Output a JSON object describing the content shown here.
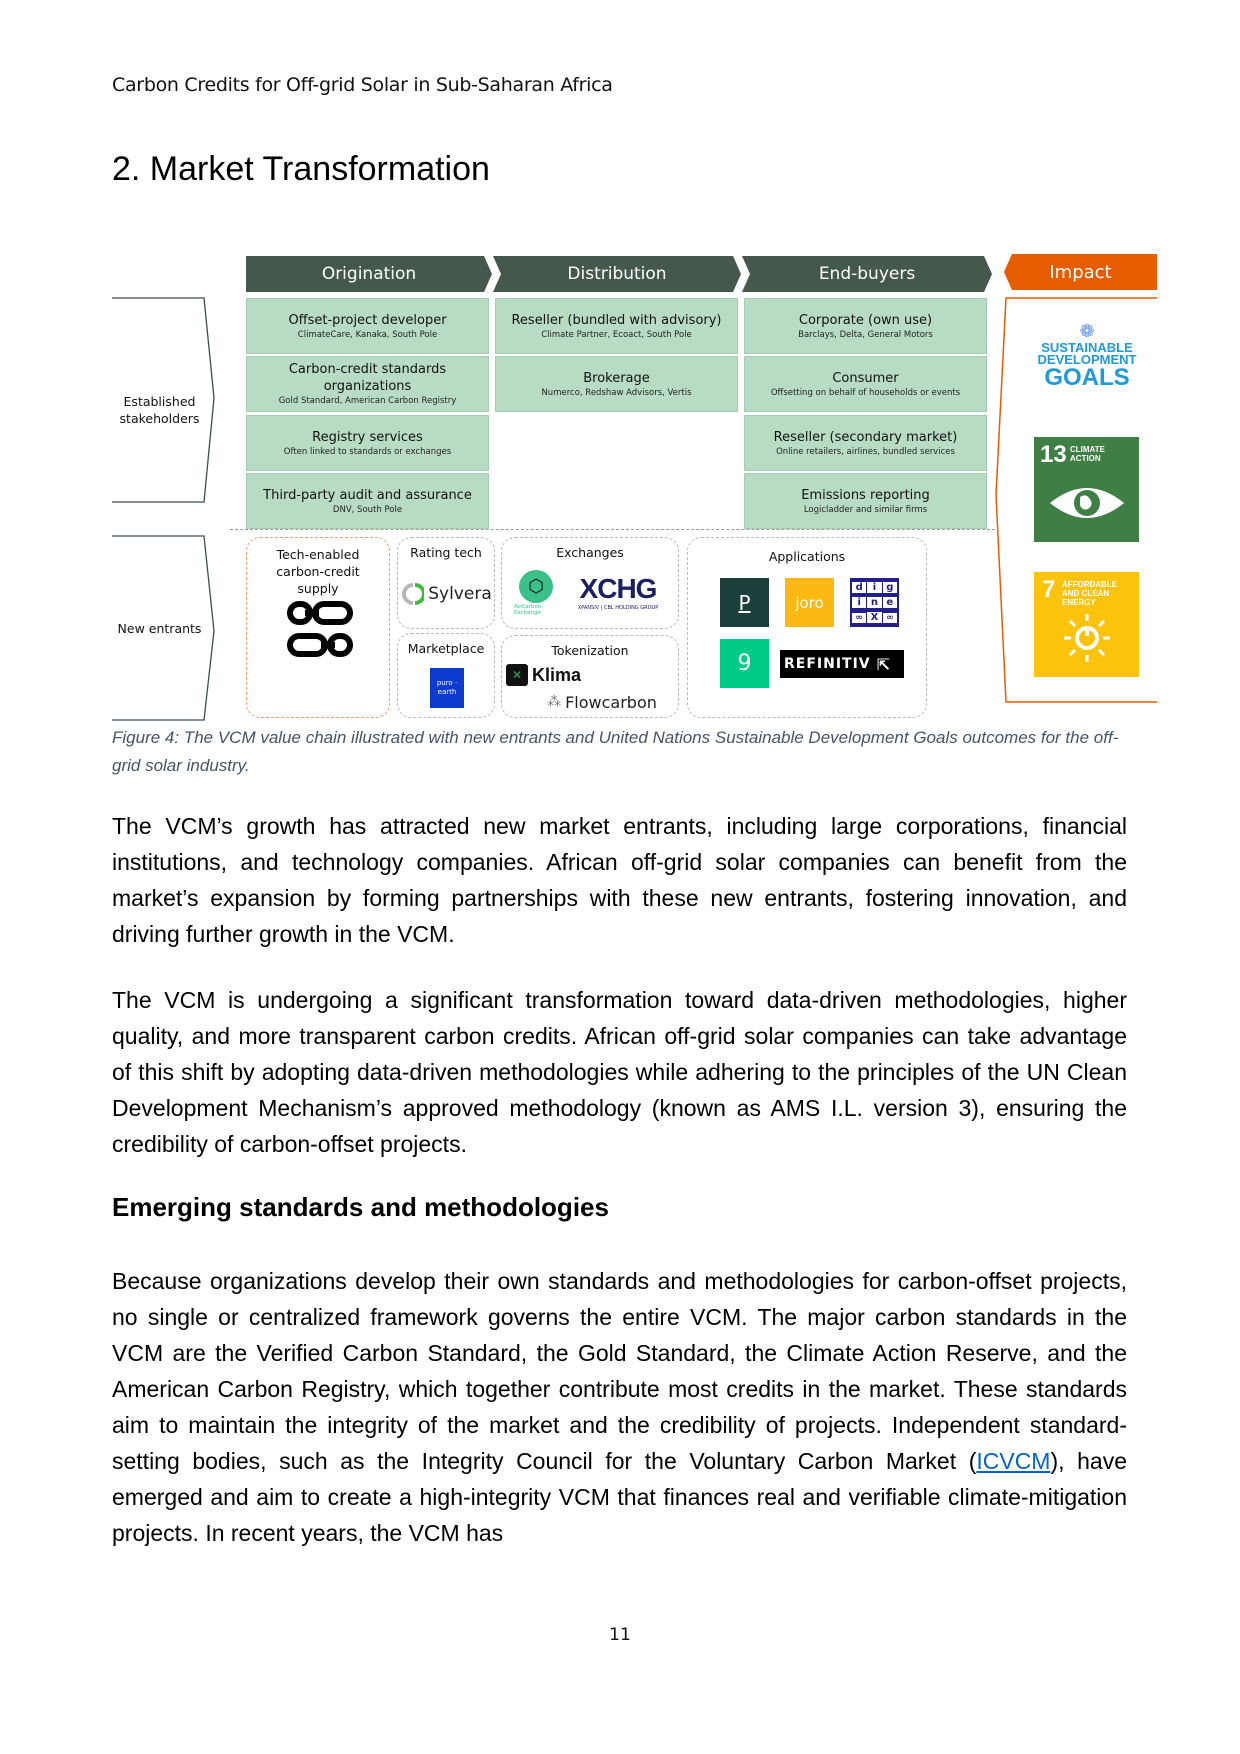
{
  "document": {
    "running_header": "Carbon Credits for Off-grid Solar in Sub-Saharan Africa",
    "section_title": "2.  Market Transformation",
    "page_number": "11"
  },
  "figure": {
    "stages": [
      "Origination",
      "Distribution",
      "End-buyers"
    ],
    "impact_label": "Impact",
    "row_labels": {
      "established": "Established stakeholders",
      "new": "New entrants"
    },
    "origination": [
      {
        "title": "Offset-project developer",
        "sub": "ClimateCare, Kanaka, South Pole"
      },
      {
        "title": "Carbon-credit standards organizations",
        "sub": "Gold Standard, American Carbon Registry"
      },
      {
        "title": "Registry services",
        "sub": "Often linked to standards or exchanges"
      },
      {
        "title": "Third-party audit and assurance",
        "sub": "DNV, South Pole"
      }
    ],
    "distribution": [
      {
        "title": "Reseller (bundled with advisory)",
        "sub": "Climate Partner, Ecoact, South Pole"
      },
      {
        "title": "Brokerage",
        "sub": "Numerco, Redshaw Advisors, Vertis"
      }
    ],
    "end_buyers": [
      {
        "title": "Corporate (own use)",
        "sub": "Barclays, Delta, General Motors"
      },
      {
        "title": "Consumer",
        "sub": "Offsetting on behalf of households or events"
      },
      {
        "title": "Reseller (secondary market)",
        "sub": "Online retailers, airlines, bundled services"
      },
      {
        "title": "Emissions reporting",
        "sub": "Logicladder and similar firms"
      }
    ],
    "new_entrants": {
      "tech_supply": {
        "title": "Tech-enabled carbon-credit supply",
        "logo": "infinity-chain-logo-icon"
      },
      "rating_tech": {
        "title": "Rating tech",
        "logos": [
          "Sylvera"
        ]
      },
      "marketplace": {
        "title": "Marketplace",
        "logos": [
          "puro · earth"
        ]
      },
      "exchanges": {
        "title": "Exchanges",
        "logos": [
          "AirCarbon Exchange",
          "XCHG"
        ],
        "xchg_sub": "XPANSIV | CBL HOLDING GROUP"
      },
      "tokenization": {
        "title": "Tokenization",
        "logos": [
          "Klima",
          "Flowcarbon"
        ]
      },
      "applications": {
        "title": "Applications",
        "logos": [
          "P",
          "joro",
          "diginex",
          "9",
          "REFINITIV"
        ],
        "diginex_letters": [
          "d",
          "i",
          "g",
          "i",
          "n",
          "e",
          "∞",
          "X",
          "∞"
        ]
      }
    },
    "impact": {
      "sdg_logo": {
        "line1": "SUSTAINABLE",
        "line2": "DEVELOPMENT",
        "line3": "GOALS"
      },
      "goals": [
        {
          "number": "13",
          "label": "CLIMATE ACTION",
          "color": "#3f7e44"
        },
        {
          "number": "7",
          "label": "AFFORDABLE AND CLEAN ENERGY",
          "color": "#fcc30b"
        }
      ]
    },
    "colors": {
      "stage_header": "#44594b",
      "cell_fill": "#b8dcc3",
      "impact_accent": "#e65c00",
      "sdg_blue": "#1f9ad6"
    },
    "caption": "Figure 4: The VCM value chain illustrated with new entrants and United Nations Sustainable Development Goals outcomes for the off-grid solar industry."
  },
  "body": {
    "p1": "The VCM’s growth has attracted new market entrants, including large corporations, financial institutions, and technology companies. African off-grid solar companies can benefit from the market’s expansion by forming partnerships with these new entrants, fostering innovation, and driving further growth in the VCM.",
    "p2": "The VCM is undergoing a significant transformation toward data-driven methodologies, higher quality, and more transparent carbon credits. African off-grid solar companies can take advantage of this shift by adopting data-driven methodologies while adhering to the principles of the UN Clean Development Mechanism’s approved methodology (known as AMS I.L. version 3), ensuring the credibility of carbon-offset projects.",
    "subheading": "Emerging standards and methodologies",
    "p3_before_link": "Because organizations develop their own standards and methodologies for carbon-offset projects, no single or centralized framework governs the entire VCM. The major carbon standards in the VCM are the Verified Carbon Standard, the Gold Standard, the Climate Action Reserve, and the American Carbon Registry, which together contribute most credits in the market. These standards aim to maintain the integrity of the market and the credibility of projects. Independent standard-setting bodies, such as the Integrity Council for the Voluntary Carbon Market (",
    "p3_link": "ICVCM",
    "p3_after_link": "), have emerged and aim to create a high-integrity VCM that finances real and verifiable climate-mitigation projects. In recent years, the VCM has"
  }
}
